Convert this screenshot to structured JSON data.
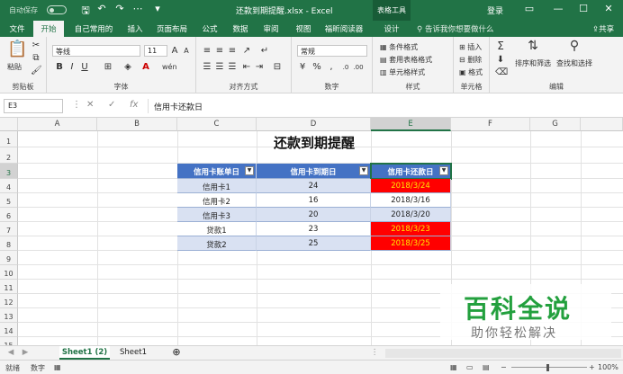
{
  "titlebar": {
    "autosave": "自动保存",
    "autosave_state": "关",
    "doc_title": "还款到期提醒.xlsx  -  Excel",
    "tools_tab": "表格工具",
    "login": "登录",
    "icons": [
      "save-icon",
      "undo-icon",
      "redo-icon",
      "customize-icon"
    ]
  },
  "tabs": [
    "文件",
    "开始",
    "自己常用的",
    "插入",
    "页面布局",
    "公式",
    "数据",
    "审阅",
    "视图",
    "福昕阅读器",
    "设计"
  ],
  "active_tab": "开始",
  "tell_me": "告诉我你想要做什么",
  "share": "共享",
  "ribbon": {
    "clipboard": {
      "paste": "粘贴",
      "label": "剪贴板"
    },
    "font": {
      "name": "等线",
      "size": "11",
      "label": "字体"
    },
    "alignment": {
      "label": "对齐方式"
    },
    "number": {
      "format": "常规",
      "label": "数字"
    },
    "styles": {
      "conditional": "条件格式",
      "table_format": "套用表格格式",
      "cell_styles": "单元格样式",
      "label": "样式"
    },
    "cells": {
      "insert": "插入",
      "delete": "删除",
      "format": "格式",
      "label": "单元格"
    },
    "editing": {
      "sort_filter": "排序和筛选",
      "find_select": "查找和选择",
      "label": "编辑"
    }
  },
  "formula_bar": {
    "name_box": "E3",
    "fx": "fx",
    "content": "信用卡还款日"
  },
  "sheet": {
    "columns": [
      "A",
      "B",
      "C",
      "D",
      "E",
      "F",
      "G"
    ],
    "selected_column": "E",
    "rows": [
      "1",
      "2",
      "3",
      "4",
      "5",
      "6",
      "7",
      "8",
      "9",
      "10",
      "11",
      "12",
      "13",
      "14",
      "15",
      "16",
      "17"
    ],
    "selected_row": "3",
    "title": "还款到期提醒",
    "table": {
      "headers": [
        "信用卡账单日",
        "信用卡到期日",
        "信用卡还款日"
      ],
      "rows": [
        {
          "name": "信用卡1",
          "due_day": "24",
          "date": "2018/3/24",
          "highlight": true
        },
        {
          "name": "信用卡2",
          "due_day": "16",
          "date": "2018/3/16",
          "highlight": false
        },
        {
          "name": "信用卡3",
          "due_day": "20",
          "date": "2018/3/20",
          "highlight": false
        },
        {
          "name": "贷款1",
          "due_day": "23",
          "date": "2018/3/23",
          "highlight": true
        },
        {
          "name": "贷款2",
          "due_day": "25",
          "date": "2018/3/25",
          "highlight": true
        }
      ]
    }
  },
  "watermark": {
    "main": "百科全说",
    "sub": "助你轻松解决"
  },
  "sheet_tabs": [
    "Sheet1 (2)",
    "Sheet1"
  ],
  "active_sheet": "Sheet1 (2)",
  "status": {
    "ready": "就绪",
    "mode": "数字",
    "zoom": "100%"
  },
  "colors": {
    "accent": "#217346",
    "header": "#4472c4",
    "band": "#d9e1f2",
    "due_fill": "#ff0000",
    "due_text": "#ffe600"
  }
}
